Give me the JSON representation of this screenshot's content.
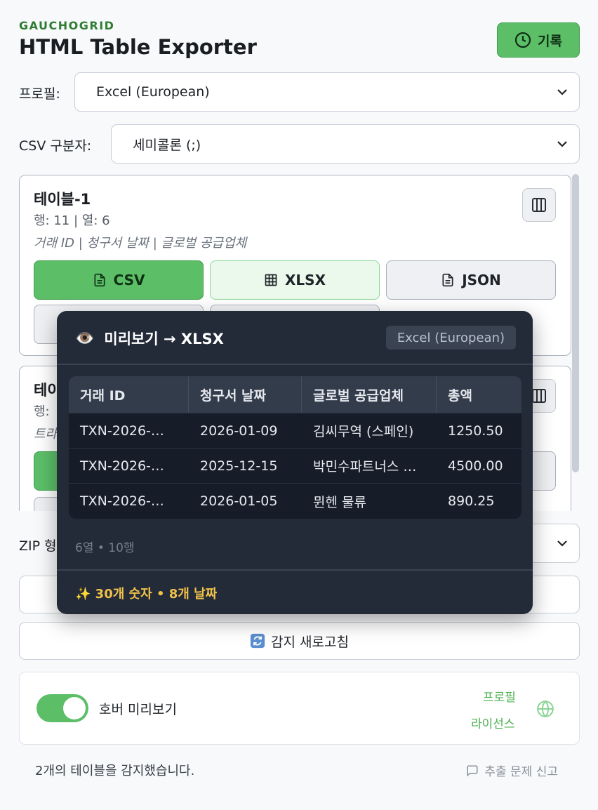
{
  "header": {
    "brand": "GAUCHOGRID",
    "title": "HTML Table Exporter",
    "history_label": "기록"
  },
  "profile": {
    "label": "프로필:",
    "value": "Excel (European)"
  },
  "delimiter": {
    "label": "CSV 구분자:",
    "value": "세미콜론 (;)"
  },
  "tables": [
    {
      "name": "테이블-1",
      "meta": "행: 11 | 열: 6",
      "columns": "거래 ID | 청구서 날짜 | 글로벌 공급업체",
      "buttons": {
        "csv": "CSV",
        "xlsx": "XLSX",
        "json": "JSON"
      }
    },
    {
      "name": "테이",
      "meta": "행:",
      "columns": "트라"
    }
  ],
  "zip": {
    "label": "ZIP 형"
  },
  "refresh_label": "감지 새로고침",
  "settings": {
    "hover_preview": "호버 미리보기",
    "hover_preview_on": true,
    "link_profile": "프로필",
    "link_license": "라이선스"
  },
  "footer": {
    "status": "2개의 테이블을 감지했습니다.",
    "report": "추출 문제 신고"
  },
  "preview": {
    "title": "미리보기 → XLSX",
    "profile_badge": "Excel (European)",
    "headers": [
      "거래 ID",
      "청구서 날짜",
      "글로벌 공급업체",
      "총액"
    ],
    "rows": [
      [
        "TXN-2026-…",
        "2026-01-09",
        "김씨무역 (스페인)",
        "1250.50"
      ],
      [
        "TXN-2026-…",
        "2025-12-15",
        "박민수파트너스 …",
        "4500.00"
      ],
      [
        "TXN-2026-…",
        "2026-01-05",
        "뮌헨 물류",
        "890.25"
      ]
    ],
    "stats": "6열 • 10행",
    "detected": "✨ 30개 숫자 • 8개 날짜"
  },
  "colors": {
    "accent": "#5cbf68",
    "brand": "#2e7d32",
    "popup_bg": "#232a38",
    "highlight": "#f0c24a"
  }
}
